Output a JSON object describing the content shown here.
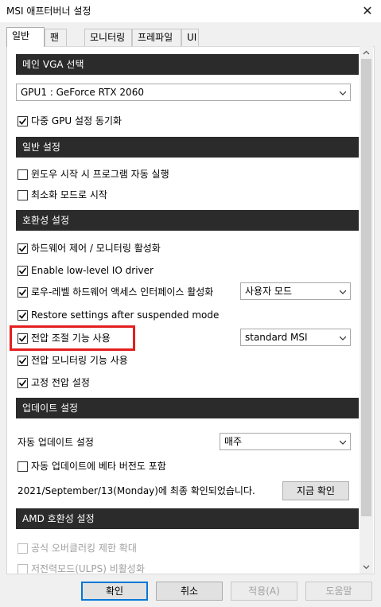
{
  "window": {
    "title": "MSI 애프터버너 설정",
    "close_glyph": "✕"
  },
  "tabs": [
    "일반",
    "팬",
    "모니터링",
    "프레파일",
    "UI"
  ],
  "sections": {
    "main_vga": "메인 VGA 선택",
    "general": "일반 설정",
    "compat": "호환성 설정",
    "update": "업데이트 설정",
    "amd": "AMD 호환성 설정"
  },
  "gpu_select": {
    "value": "GPU1 : GeForce RTX 2060"
  },
  "checkboxes": {
    "sync_multi_gpu": {
      "label": "다중 GPU 설정 동기화",
      "checked": true
    },
    "start_with_windows": {
      "label": "윈도우 시작 시 프로그램 자동 실행",
      "checked": false
    },
    "start_minimized": {
      "label": "최소화 모드로 시작",
      "checked": false
    },
    "enable_hw_monitoring": {
      "label": "하드웨어 제어 / 모니터링 활성화",
      "checked": true
    },
    "low_level_io": {
      "label": "Enable low-level IO driver",
      "checked": true
    },
    "low_level_hw_access": {
      "label": "로우-레벨 하드웨어 액세스 인터페이스 활성화",
      "checked": true
    },
    "restore_after_suspend": {
      "label": "Restore settings after suspended mode",
      "checked": true
    },
    "voltage_control": {
      "label": "전압 조절 기능 사용",
      "checked": true
    },
    "voltage_monitoring": {
      "label": "전압 모니터링 기능 사용",
      "checked": true
    },
    "fixed_voltage": {
      "label": "고정 전압 설정",
      "checked": true
    },
    "beta_updates": {
      "label": "자동 업데이트에 베타 버전도 포함",
      "checked": false
    },
    "extend_oc_limits": {
      "label": "공식 오버클러킹 제한 확대",
      "checked": false
    },
    "ulps_disable": {
      "label": "저전력모드(ULPS) 비활성화",
      "checked": false
    }
  },
  "access_mode_select": {
    "value": "사용자 모드"
  },
  "voltage_mode_select": {
    "value": "standard MSI"
  },
  "auto_update": {
    "label": "자동 업데이트 설정",
    "value": "매주"
  },
  "last_check": {
    "text": "2021/September/13(Monday)에 최종 확인되었습니다.",
    "button": "지금 확인"
  },
  "footer": {
    "ok": "확인",
    "cancel": "취소",
    "apply": "적용(A)",
    "help": "도움말"
  },
  "icons": {
    "check": "check-icon",
    "dropdown": "chevron-down-icon",
    "close": "close-icon"
  },
  "colors": {
    "section_header": "#2b2b2b",
    "highlight": "#e41e1e",
    "accent": "#0078d7"
  }
}
